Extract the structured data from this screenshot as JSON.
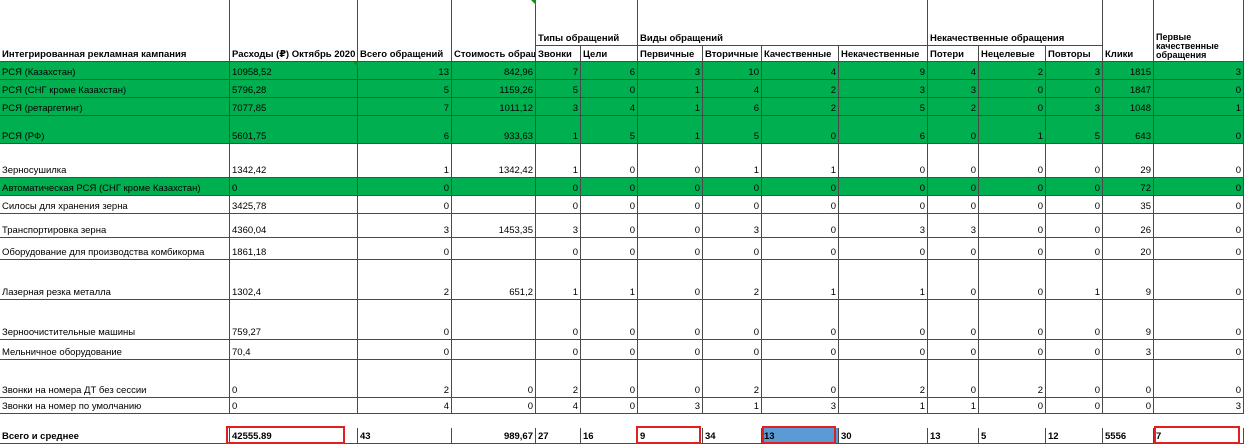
{
  "headers": {
    "campaign": "Интегрированная рекламная кампания",
    "expenses": "Расходы (₽) Октябрь 2020",
    "total_requests": "Всего обращений",
    "request_cost": "Стоимость обращ",
    "types_group": "Типы обращений",
    "calls": "Звонки",
    "goals": "Цели",
    "kinds_group": "Виды обращений",
    "primary": "Первичные",
    "secondary": "Вторичные",
    "quality": "Качественные",
    "nonquality": "Некачественные",
    "nonquality_group": "Некачественные обращения",
    "losses": "Потери",
    "nontarget": "Нецелевые",
    "repeats": "Повторы",
    "clicks": "Клики",
    "first_quality": "Первые качественные обращения"
  },
  "rows": [
    {
      "name": "РСЯ (Казахстан)",
      "green": true,
      "vals": [
        "10958,52",
        "13",
        "842,96",
        "7",
        "6",
        "3",
        "10",
        "4",
        "9",
        "4",
        "2",
        "3",
        "1815",
        "3"
      ]
    },
    {
      "name": "РСЯ (СНГ кроме Казахстан)",
      "green": true,
      "vals": [
        "5796,28",
        "5",
        "1159,26",
        "5",
        "0",
        "1",
        "4",
        "2",
        "3",
        "3",
        "0",
        "0",
        "1847",
        "0"
      ]
    },
    {
      "name": "РСЯ (ретаргетинг)",
      "green": true,
      "vals": [
        "7077,85",
        "7",
        "1011,12",
        "3",
        "4",
        "1",
        "6",
        "2",
        "5",
        "2",
        "0",
        "3",
        "1048",
        "1"
      ]
    },
    {
      "name": "РСЯ (РФ)",
      "green": true,
      "vals": [
        "5601,75",
        "6",
        "933,63",
        "1",
        "5",
        "1",
        "5",
        "0",
        "6",
        "0",
        "1",
        "5",
        "643",
        "0"
      ]
    },
    {
      "name": "Зерносушилка",
      "green": false,
      "vals": [
        "1342,42",
        "1",
        "1342,42",
        "1",
        "0",
        "0",
        "1",
        "1",
        "0",
        "0",
        "0",
        "0",
        "29",
        "0"
      ]
    },
    {
      "name": "Автоматическая РСЯ (СНГ кроме Казахстан)",
      "green": true,
      "vals": [
        "0",
        "0",
        "",
        "0",
        "0",
        "0",
        "0",
        "0",
        "0",
        "0",
        "0",
        "0",
        "72",
        "0"
      ]
    },
    {
      "name": "Силосы для хранения зерна",
      "green": false,
      "vals": [
        "3425,78",
        "0",
        "",
        "0",
        "0",
        "0",
        "0",
        "0",
        "0",
        "0",
        "0",
        "0",
        "35",
        "0"
      ]
    },
    {
      "name": "Транспортировка зерна",
      "green": false,
      "vals": [
        "4360,04",
        "3",
        "1453,35",
        "3",
        "0",
        "0",
        "3",
        "0",
        "3",
        "3",
        "0",
        "0",
        "26",
        "0"
      ]
    },
    {
      "name": "Оборудование для производства комбикорма",
      "green": false,
      "vals": [
        "1861,18",
        "0",
        "",
        "0",
        "0",
        "0",
        "0",
        "0",
        "0",
        "0",
        "0",
        "0",
        "20",
        "0"
      ]
    },
    {
      "name": "Лазерная резка металла",
      "green": false,
      "vals": [
        "1302,4",
        "2",
        "651,2",
        "1",
        "1",
        "0",
        "2",
        "1",
        "1",
        "0",
        "0",
        "1",
        "9",
        "0"
      ]
    },
    {
      "name": "Зерноочистительные машины",
      "green": false,
      "vals": [
        "759,27",
        "0",
        "",
        "0",
        "0",
        "0",
        "0",
        "0",
        "0",
        "0",
        "0",
        "0",
        "9",
        "0"
      ]
    },
    {
      "name": "Мельничное оборудование",
      "green": false,
      "vals": [
        "70,4",
        "0",
        "",
        "0",
        "0",
        "0",
        "0",
        "0",
        "0",
        "0",
        "0",
        "0",
        "3",
        "0"
      ]
    },
    {
      "name": "Звонки на номера ДТ без сессии",
      "green": false,
      "vals": [
        "0",
        "2",
        "0",
        "2",
        "0",
        "0",
        "2",
        "0",
        "2",
        "0",
        "2",
        "0",
        "0",
        "0"
      ]
    },
    {
      "name": "Звонки на номер по умолчанию",
      "green": false,
      "vals": [
        "0",
        "4",
        "0",
        "4",
        "0",
        "3",
        "1",
        "3",
        "1",
        "1",
        "0",
        "0",
        "0",
        "3"
      ]
    }
  ],
  "totals": {
    "name": "Всего и среднее",
    "vals": [
      "42555.89",
      "43",
      "989,67",
      "27",
      "16",
      "9",
      "34",
      "13",
      "30",
      "13",
      "5",
      "12",
      "5556",
      "7"
    ]
  },
  "colors": {
    "green_fill": "#00b050",
    "blue_fill": "#5b9bd5",
    "highlight_border": "#e02020"
  }
}
